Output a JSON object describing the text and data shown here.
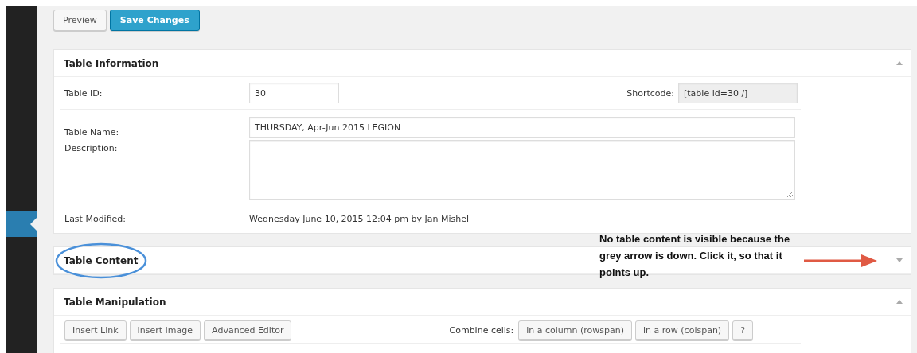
{
  "toolbar": {
    "buttons": [
      {
        "label": "Preview",
        "primary": false
      },
      {
        "label": "Save Changes",
        "primary": true
      }
    ]
  },
  "table_information": {
    "title": "Table Information",
    "expanded": true,
    "table_id": {
      "label": "Table ID:",
      "value": "30"
    },
    "shortcode": {
      "label": "Shortcode:",
      "value": "[table id=30 /]"
    },
    "table_name": {
      "label": "Table Name:",
      "value": "THURSDAY, Apr-Jun 2015 LEGION"
    },
    "description": {
      "label": "Description:"
    },
    "last_modified": {
      "label": "Last Modified:",
      "value": "Wednesday June 10, 2015 12:04 pm by Jan Mishel"
    }
  },
  "table_content": {
    "title": "Table Content",
    "expanded": false
  },
  "table_manipulation": {
    "title": "Table Manipulation",
    "expanded": true,
    "buttons": [
      "Insert Link",
      "Insert Image",
      "Advanced Editor"
    ],
    "combine_label": "Combine cells:",
    "combine_buttons": [
      "in a column (rowspan)",
      "in a row (colspan)",
      "?"
    ]
  },
  "annotation": {
    "note": "No table content is visible because the grey arrow is down. Click it, so that it points up."
  }
}
